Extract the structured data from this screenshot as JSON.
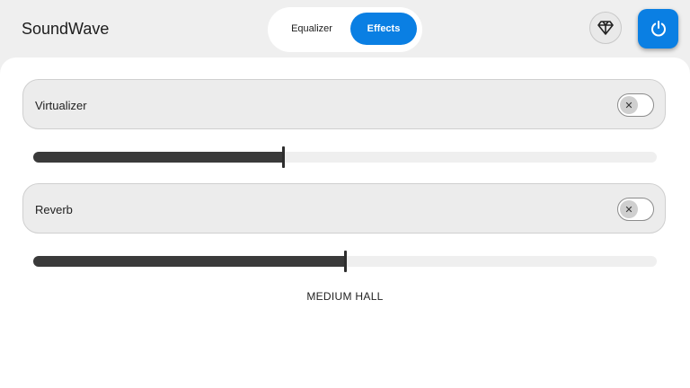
{
  "app": {
    "title": "SoundWave"
  },
  "tabs": [
    {
      "label": "Equalizer",
      "selected": false
    },
    {
      "label": "Effects",
      "selected": true
    }
  ],
  "header": {
    "premium_icon": "diamond-icon",
    "power_icon": "power-icon"
  },
  "colors": {
    "accent": "#0a7fe3",
    "background": "#efefef",
    "panel": "#ffffff"
  },
  "effects": {
    "virtualizer": {
      "label": "Virtualizer",
      "enabled": false,
      "level": 0.4
    },
    "reverb": {
      "label": "Reverb",
      "enabled": false,
      "level": 0.5,
      "preset": "MEDIUM HALL"
    }
  }
}
